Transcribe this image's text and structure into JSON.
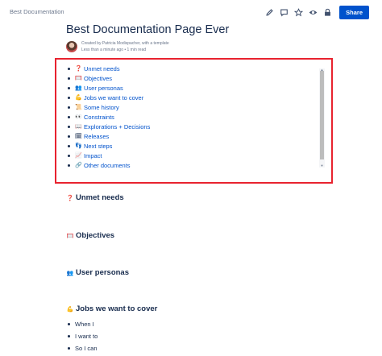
{
  "breadcrumb": {
    "label": "Best Documentation"
  },
  "toolbar": {
    "icons": [
      "pencil-icon",
      "comment-icon",
      "star-icon",
      "eye-icon",
      "restrict-icon"
    ],
    "share_label": "Share"
  },
  "page": {
    "title": "Best Documentation Page Ever",
    "byline": {
      "created_by": "Created by Patricia Modispacher, with a template",
      "meta": "Less than a minute ago • 1 min read"
    }
  },
  "toc": {
    "items": [
      {
        "emoji": "❓",
        "label": "Unmet needs"
      },
      {
        "emoji": "🥅",
        "label": "Objectives"
      },
      {
        "emoji": "👥",
        "label": "User personas"
      },
      {
        "emoji": "💪",
        "label": "Jobs we want to cover"
      },
      {
        "emoji": "📜",
        "label": "Some history"
      },
      {
        "emoji": "👀",
        "label": "Constraints"
      },
      {
        "emoji": "📖",
        "label": "Explorations + Decisions"
      },
      {
        "emoji": "🗓",
        "label": "Releases"
      },
      {
        "emoji": "👣",
        "label": "Next steps"
      },
      {
        "emoji": "📈",
        "label": "Impact"
      },
      {
        "emoji": "🔗",
        "label": "Other documents"
      }
    ]
  },
  "sections": [
    {
      "emoji": "❓",
      "title": "Unmet needs"
    },
    {
      "emoji": "🥅",
      "title": "Objectives"
    },
    {
      "emoji": "👥",
      "title": "User personas"
    },
    {
      "emoji": "💪",
      "title": "Jobs we want to cover"
    }
  ],
  "jobs": {
    "items": [
      "When I",
      "I want to",
      "So I can"
    ]
  }
}
